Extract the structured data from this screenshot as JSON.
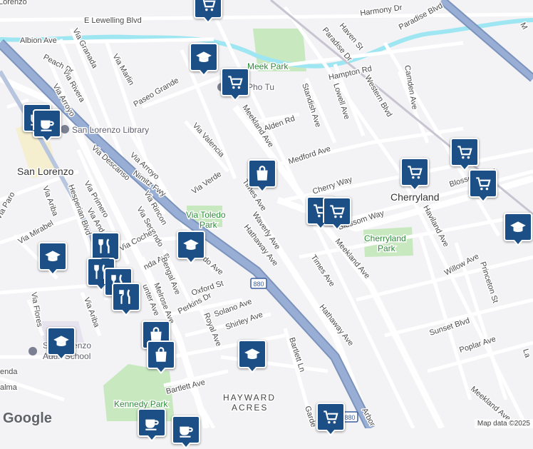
{
  "map": {
    "places": {
      "san_lorenzo": "San Lorenzo",
      "cherryland": "Cherryland",
      "hayward_acres_1": "HAYWARD",
      "hayward_acres_2": "ACRES"
    },
    "parks": {
      "meek_park": "Meek Park",
      "via_toledo_park_1": "Via Toledo",
      "via_toledo_park_2": "Park",
      "cherryland_park_1": "Cherryland",
      "cherryland_park_2": "Park",
      "kennedy_park": "Kennedy Park"
    },
    "pois": {
      "library": "San Lorenzo Library",
      "adult_school_1": "San Lorenzo",
      "adult_school_2": "Adult School",
      "pho": "Pho Tu"
    },
    "highway_shield": "880",
    "streets": {
      "lorenzo": "Lorenzo",
      "e_lewelling": "E Lewelling Blvd",
      "albion": "Albion Ave",
      "harmony": "Harmony Dr",
      "haven": "Haven St",
      "paradise_dr": "Paradise Dr",
      "paradise_blvd": "Paradise Blvd",
      "via_granada": "Via Granada",
      "peach": "Peach Dr",
      "via_rivera": "Via Rivera",
      "via_arroyo_1": "Via Arroyo",
      "via_marlin": "Via Marlin",
      "paseo_grande": "Paseo Grande",
      "hampton": "Hampton Rd",
      "camden": "Camden Ave",
      "western": "Western Blvd",
      "lowell": "Lowell Ave",
      "standish": "Standish Ave",
      "alden": "Alden Rd",
      "meekland_1": "Meekland Ave",
      "via_valencia": "Via Valencia",
      "via_arroyo_2": "Via Arroyo",
      "medford": "Medford Ave",
      "blossom_1": "Blossom Way",
      "cherry": "Cherry Way",
      "blossom_2": "Blossom Way",
      "via_descanso": "Via Descanso",
      "nimitz": "Nimitz Fwy",
      "via_verde": "Via Verde",
      "times_1": "Times Ave",
      "hesperian": "Hesperian Blvd",
      "via_primero": "Via Primero",
      "via_rincon": "Via Rincon",
      "via_ariba_1": "Via Ariba",
      "via_segundo": "Via Segundo",
      "via_paro": "Via Paro",
      "via_mirabel": "Via Mirabel",
      "via_anderson": "Via Ande",
      "via_coches": "Via Coches",
      "haviland": "Haviland Ave",
      "waverly": "Waverly Ave",
      "meekland_2": "Meekland Ave",
      "hathaway_1": "Hathaway Ave",
      "willow": "Willow Ave",
      "miranda": "nda Ave",
      "bengal": "Bengal Ave",
      "via_toledo": "do Ave",
      "times_2": "Times Ave",
      "princeton": "Princeton St",
      "melrose": "Melrose Ave",
      "hunter": "unter Ave",
      "oxford": "Oxford St",
      "perkins": "Perkins Dr",
      "via_ariba_2": "Via Ariba",
      "via_flores": "Via Flores",
      "solano": "Solano Ave",
      "royal": "Royal Ave",
      "shirley": "Shirley Ave",
      "sunset": "Sunset Blvd",
      "hathaway_2": "Hathaway Ave",
      "poplar": "Poplar Ave",
      "bartlett_ln": "Bartlett Ln",
      "bartlett_ave": "Bartlett Ave",
      "meekland_3": "Meekland Ave",
      "garden": "Garde",
      "arbor": "Arbor",
      "l_ave": "La",
      "palma": "alma",
      "enda": "enda",
      "m_top": "M",
      "rd_label": "rd"
    },
    "markers": [
      {
        "type": "shopping-cart",
        "name": "shopping-cart-marker-top"
      },
      {
        "type": "school",
        "name": "school-marker-paseo"
      },
      {
        "type": "shopping-cart",
        "name": "shopping-cart-marker-pho"
      },
      {
        "type": "cafe",
        "name": "cafe-marker-library-1"
      },
      {
        "type": "cafe",
        "name": "cafe-marker-library-2"
      },
      {
        "type": "shopping-bag",
        "name": "shopping-bag-marker-meekland"
      },
      {
        "type": "shopping-cart",
        "name": "shopping-cart-marker-cherry-1"
      },
      {
        "type": "shopping-cart",
        "name": "shopping-cart-marker-cherry-2"
      },
      {
        "type": "shopping-cart",
        "name": "shopping-cart-marker-blossom-1"
      },
      {
        "type": "shopping-cart",
        "name": "shopping-cart-marker-blossom-2"
      },
      {
        "type": "shopping-cart",
        "name": "shopping-cart-marker-blossom-3"
      },
      {
        "type": "school",
        "name": "school-marker-east"
      },
      {
        "type": "school",
        "name": "school-marker-west"
      },
      {
        "type": "restaurant",
        "name": "restaurant-marker-1"
      },
      {
        "type": "school",
        "name": "school-marker-via-toledo"
      },
      {
        "type": "restaurant",
        "name": "restaurant-marker-2"
      },
      {
        "type": "restaurant",
        "name": "restaurant-marker-3"
      },
      {
        "type": "restaurant",
        "name": "restaurant-marker-4"
      },
      {
        "type": "shopping-bag",
        "name": "shopping-bag-marker-1"
      },
      {
        "type": "shopping-bag",
        "name": "shopping-bag-marker-2"
      },
      {
        "type": "school",
        "name": "school-marker-adult"
      },
      {
        "type": "school",
        "name": "school-marker-shirley"
      },
      {
        "type": "shopping-cart",
        "name": "shopping-cart-marker-bottom"
      },
      {
        "type": "cafe",
        "name": "cafe-marker-bottom-1"
      },
      {
        "type": "cafe",
        "name": "cafe-marker-bottom-2"
      }
    ],
    "colors": {
      "marker": "#1b4f86",
      "highway": "#8ba3c9",
      "park": "#c8e8c0",
      "water": "#9ee6f2"
    }
  },
  "logo": "Google",
  "attribution": "Map data ©2025"
}
